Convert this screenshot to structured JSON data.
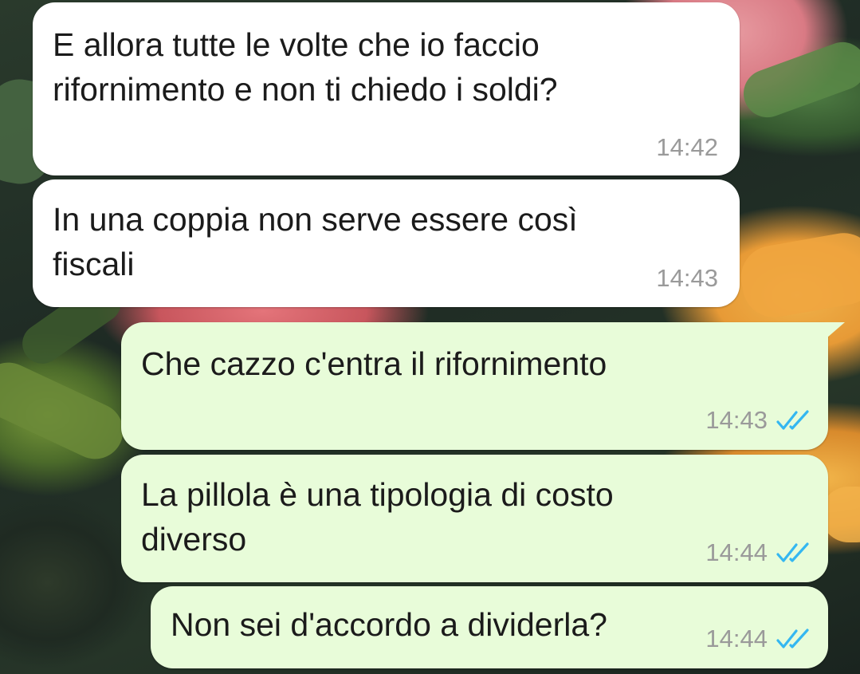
{
  "chat": {
    "messages": [
      {
        "direction": "incoming",
        "text": "E allora tutte le volte che io faccio\nrifornimento e non ti chiedo i soldi?",
        "time": "14:42"
      },
      {
        "direction": "incoming",
        "text": "In una coppia non serve essere così\nfiscali",
        "time": "14:43"
      },
      {
        "direction": "outgoing",
        "text": "Che cazzo c'entra il rifornimento",
        "time": "14:43",
        "status": "read",
        "status_icon": "double-check-icon"
      },
      {
        "direction": "outgoing",
        "text": "La pillola è una tipologia di costo\ndiverso",
        "time": "14:44",
        "status": "read",
        "status_icon": "double-check-icon"
      },
      {
        "direction": "outgoing",
        "text": "Non sei d'accordo a dividerla?",
        "time": "14:44",
        "status": "read",
        "status_icon": "double-check-icon"
      }
    ]
  },
  "colors": {
    "incoming_bubble": "#ffffff",
    "outgoing_bubble": "#e8fcd9",
    "read_tick": "#34b7f1",
    "timestamp": "#9a9a9a"
  }
}
